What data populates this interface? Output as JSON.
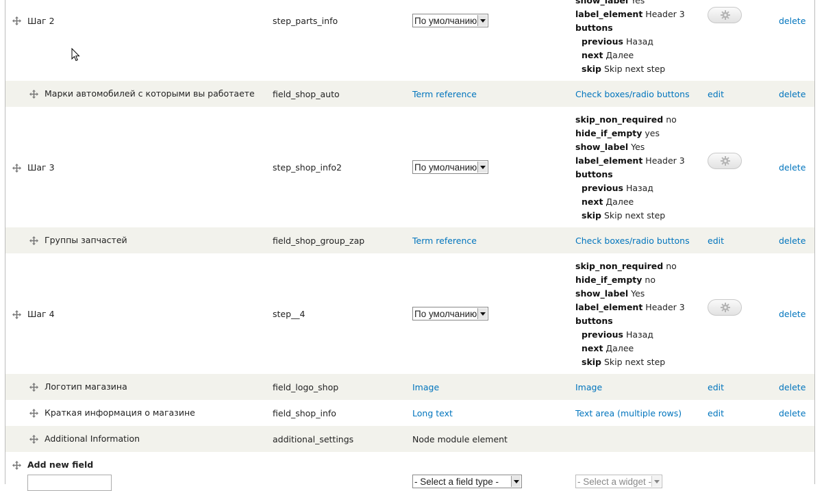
{
  "rows": [
    {
      "type": "group",
      "label": "Шаг 2",
      "machine_name": "step_parts_info",
      "format_select": "По умолчанию",
      "settings": [
        {
          "key": "show_label",
          "value": "Yes",
          "indent": false
        },
        {
          "key": "label_element",
          "value": "Header 3",
          "indent": false
        },
        {
          "key": "buttons",
          "value": "",
          "indent": false
        },
        {
          "key": "previous",
          "value": "Назад",
          "indent": true
        },
        {
          "key": "next",
          "value": "Далее",
          "indent": true
        },
        {
          "key": "skip",
          "value": "Skip next step",
          "indent": true
        }
      ],
      "delete": "delete"
    },
    {
      "type": "field",
      "label": "Марки автомобилей с которыми вы работаете",
      "machine_name": "field_shop_auto",
      "field_type": "Term reference",
      "widget": "Check boxes/radio buttons",
      "edit": "edit",
      "delete": "delete"
    },
    {
      "type": "group",
      "label": "Шаг 3",
      "machine_name": "step_shop_info2",
      "format_select": "По умолчанию",
      "settings": [
        {
          "key": "skip_non_required",
          "value": "no",
          "indent": false
        },
        {
          "key": "hide_if_empty",
          "value": "yes",
          "indent": false
        },
        {
          "key": "show_label",
          "value": "Yes",
          "indent": false
        },
        {
          "key": "label_element",
          "value": "Header 3",
          "indent": false
        },
        {
          "key": "buttons",
          "value": "",
          "indent": false
        },
        {
          "key": "previous",
          "value": "Назад",
          "indent": true
        },
        {
          "key": "next",
          "value": "Далее",
          "indent": true
        },
        {
          "key": "skip",
          "value": "Skip next step",
          "indent": true
        }
      ],
      "delete": "delete"
    },
    {
      "type": "field",
      "label": "Группы запчастей",
      "machine_name": "field_shop_group_zap",
      "field_type": "Term reference",
      "widget": "Check boxes/radio buttons",
      "edit": "edit",
      "delete": "delete"
    },
    {
      "type": "group",
      "label": "Шаг 4",
      "machine_name": "step__4",
      "format_select": "По умолчанию",
      "settings": [
        {
          "key": "skip_non_required",
          "value": "no",
          "indent": false
        },
        {
          "key": "hide_if_empty",
          "value": "no",
          "indent": false
        },
        {
          "key": "show_label",
          "value": "Yes",
          "indent": false
        },
        {
          "key": "label_element",
          "value": "Header 3",
          "indent": false
        },
        {
          "key": "buttons",
          "value": "",
          "indent": false
        },
        {
          "key": "previous",
          "value": "Назад",
          "indent": true
        },
        {
          "key": "next",
          "value": "Далее",
          "indent": true
        },
        {
          "key": "skip",
          "value": "Skip next step",
          "indent": true
        }
      ],
      "delete": "delete"
    },
    {
      "type": "field",
      "label": "Логотип магазина",
      "machine_name": "field_logo_shop",
      "field_type": "Image",
      "widget": "Image",
      "edit": "edit",
      "delete": "delete"
    },
    {
      "type": "field",
      "label": "Краткая информация о магазине",
      "machine_name": "field_shop_info",
      "field_type": "Long text",
      "widget": "Text area (multiple rows)",
      "edit": "edit",
      "delete": "delete"
    },
    {
      "type": "extra",
      "label": "Additional Information",
      "machine_name": "additional_settings",
      "description": "Node module element"
    }
  ],
  "add_new_field": {
    "label": "Add new field",
    "field_type_select": "- Select a field type -",
    "widget_select": "- Select a widget -"
  },
  "icons": {
    "drag": "drag-handle-icon",
    "gear": "gear-icon",
    "cursor": "mouse-pointer-icon"
  },
  "colors": {
    "link": "#0074bd",
    "stripe": "#f2f2ec",
    "border": "#bcbcbc"
  }
}
